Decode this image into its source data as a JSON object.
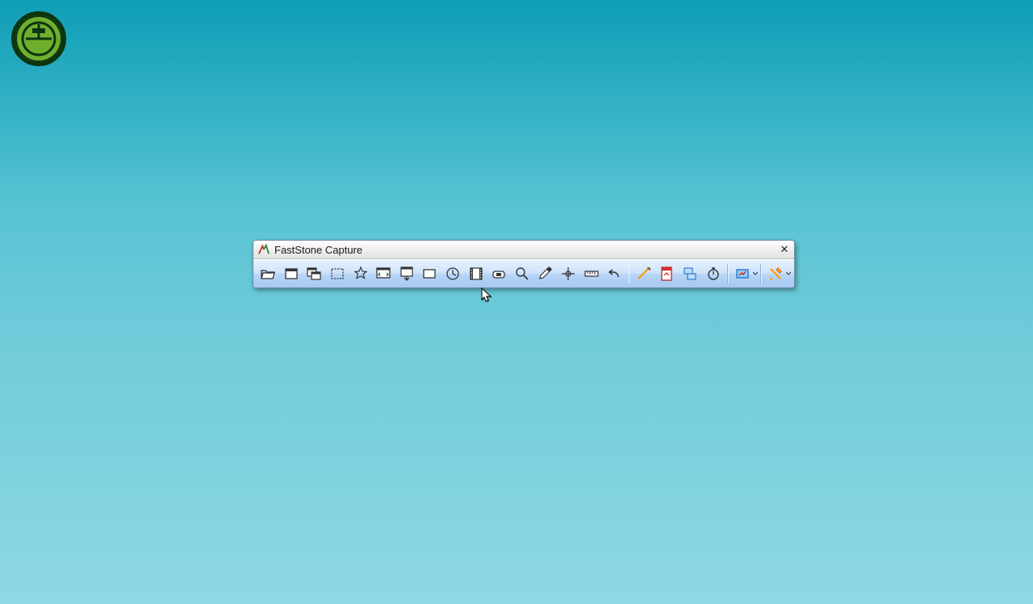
{
  "desktop": {
    "shortcut_name": "application-shortcut"
  },
  "window": {
    "title": "FastStone Capture",
    "close_label": "✕",
    "toolbar": {
      "buttons": [
        {
          "id": "open-file",
          "name": "open-file-button"
        },
        {
          "id": "capture-active-window",
          "name": "capture-active-window-button"
        },
        {
          "id": "capture-window-object",
          "name": "capture-window-object-button"
        },
        {
          "id": "capture-rectangle",
          "name": "capture-rectangle-button"
        },
        {
          "id": "capture-freehand",
          "name": "capture-freehand-button"
        },
        {
          "id": "capture-full-screen",
          "name": "capture-full-screen-button"
        },
        {
          "id": "capture-scrolling",
          "name": "capture-scrolling-window-button"
        },
        {
          "id": "capture-fixed-region",
          "name": "capture-fixed-region-button"
        },
        {
          "id": "repeat-last-capture",
          "name": "repeat-last-capture-button"
        },
        {
          "id": "screen-recorder",
          "name": "screen-recorder-button"
        },
        {
          "id": "capture-delay",
          "name": "capture-delay-button"
        },
        {
          "id": "screen-magnifier",
          "name": "screen-magnifier-button"
        },
        {
          "id": "screen-color-picker",
          "name": "color-picker-button"
        },
        {
          "id": "screen-crosshair",
          "name": "screen-crosshair-button"
        },
        {
          "id": "screen-ruler",
          "name": "screen-ruler-button"
        },
        {
          "id": "undo",
          "name": "undo-button"
        },
        {
          "id": "screen-focus",
          "name": "screen-focus-button"
        },
        {
          "id": "convert-to-pdf",
          "name": "convert-to-pdf-button"
        },
        {
          "id": "join-images",
          "name": "join-images-button"
        },
        {
          "id": "auto-capture-timer",
          "name": "auto-capture-button"
        },
        {
          "id": "output-options",
          "name": "output-options-button",
          "dropdown": true
        },
        {
          "id": "settings",
          "name": "settings-button",
          "dropdown": true
        }
      ],
      "separators_after": [
        "undo",
        "auto-capture-timer",
        "output-options"
      ]
    }
  }
}
